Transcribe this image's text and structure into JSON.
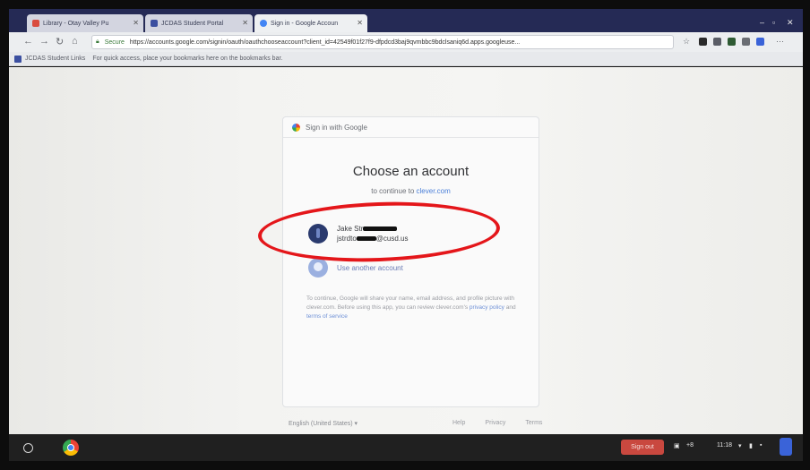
{
  "browser": {
    "tabs": [
      {
        "label": "Library - Otay Valley Pu",
        "favicon_color": "#d94b3f",
        "active": false
      },
      {
        "label": "JCDAS Student Portal",
        "favicon_color": "#3b4fa0",
        "active": false
      },
      {
        "label": "Sign in - Google Accoun",
        "favicon_color": "#4285f4",
        "active": true
      }
    ],
    "address_security": "Secure",
    "url": "https://accounts.google.com/signin/oauth/oauthchooseaccount?client_id=42549f01f27f9-dfpdcd3baj9qvmbbc9bdclsaniq6d.apps.googleuse...",
    "bookmark": "JCDAS Student Links",
    "bookmark_hint": "For quick access, place your bookmarks here on the bookmarks bar."
  },
  "signin": {
    "header": "Sign in with Google",
    "title": "Choose an account",
    "subtitle_prefix": "to continue to ",
    "subtitle_link": "clever.com",
    "account_name": "Jake Str",
    "account_email_prefix": "jstrdto",
    "account_email_suffix": "@cusd.us",
    "other_account": "Use another account",
    "disclaimer_text": "To continue, Google will share your name, email address, and profile picture with clever.com. Before using this app, you can review clever.com's ",
    "disclaimer_privacy": "privacy policy",
    "disclaimer_and": " and ",
    "disclaimer_terms": "terms of service",
    "language": "English (United States) ▾",
    "footer_links": [
      "Help",
      "Privacy",
      "Terms"
    ]
  },
  "shelf": {
    "signout_label": "Sign out",
    "time": "11:18",
    "count": "+8"
  },
  "colors": {
    "highlight": "#e4161a",
    "link": "#4a7fd8",
    "tabstrip": "#252a55",
    "signout": "#c9483f"
  }
}
